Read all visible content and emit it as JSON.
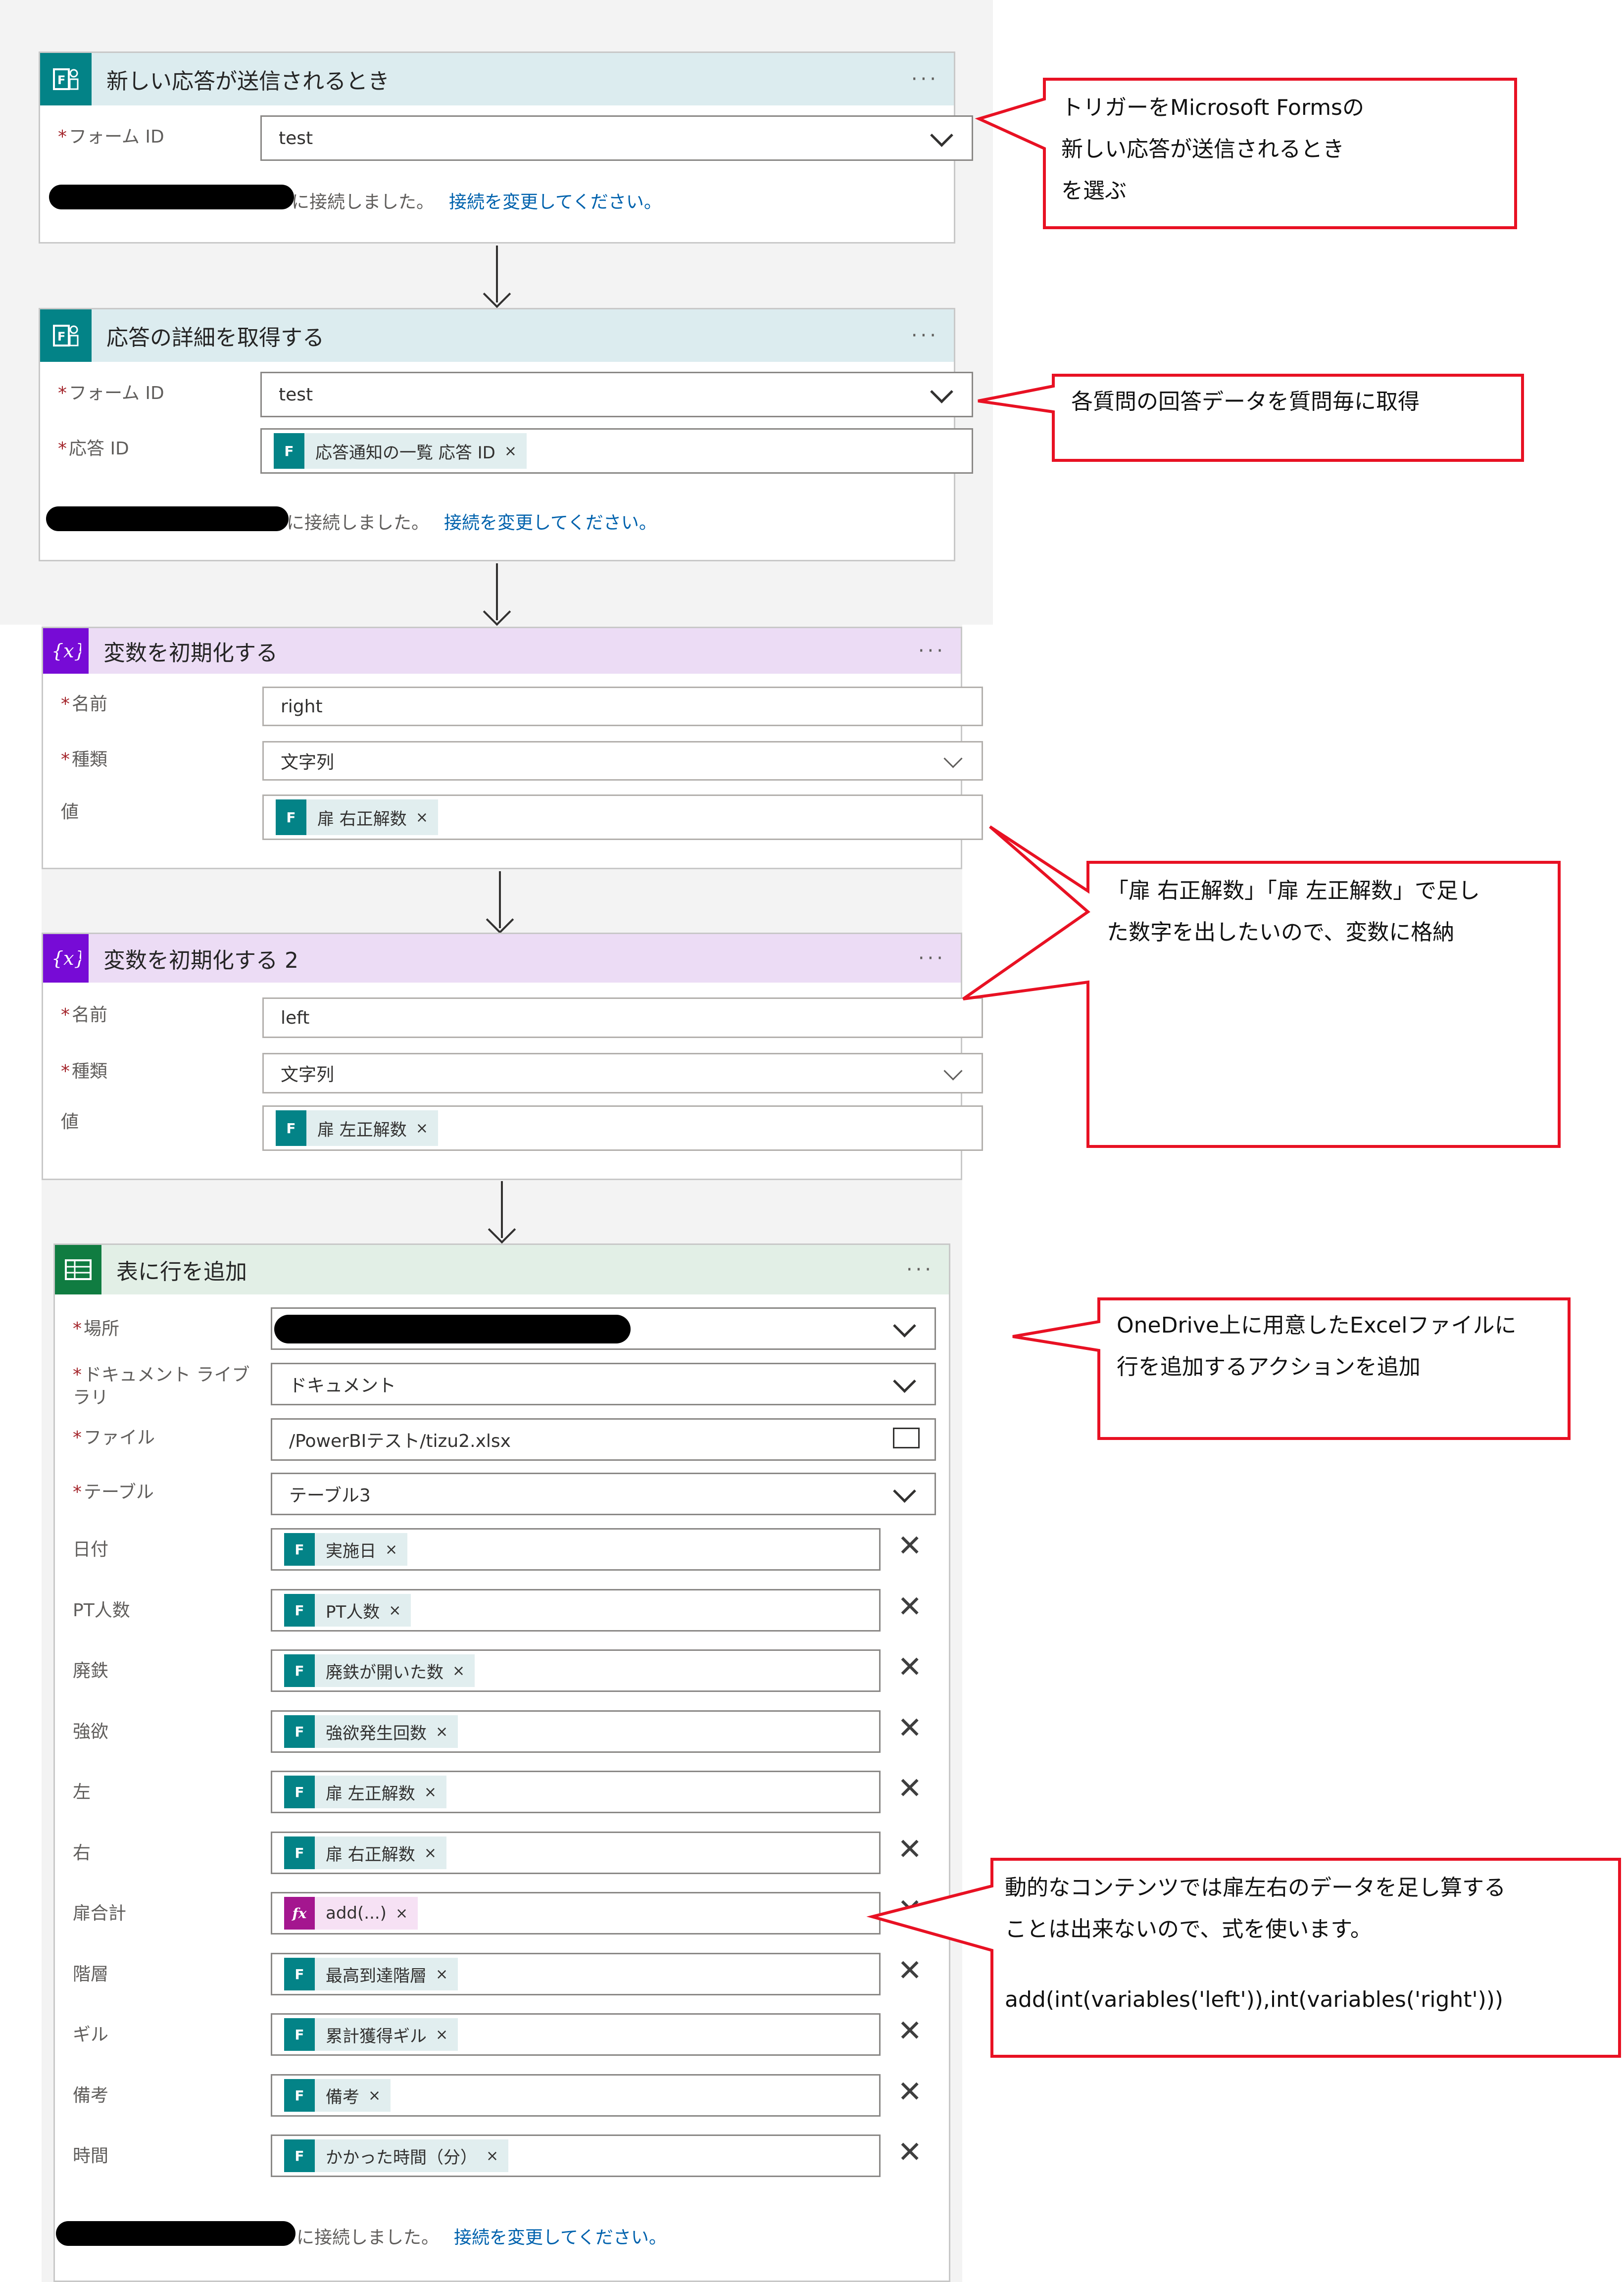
{
  "cards": {
    "trigger": {
      "title": "新しい応答が送信されるとき",
      "more": "···",
      "form_id_label": "フォーム ID",
      "form_id_value": "test",
      "connected_text": "に接続しました。",
      "change_link": "接続を変更してください。"
    },
    "get_details": {
      "title": "応答の詳細を取得する",
      "more": "···",
      "form_id_label": "フォーム ID",
      "form_id_value": "test",
      "response_id_label": "応答 ID",
      "response_id_token": "応答通知の一覧 応答 ID",
      "connected_text": "に接続しました。",
      "change_link": "接続を変更してください。"
    },
    "init_var_1": {
      "title": "変数を初期化する",
      "more": "···",
      "name_label": "名前",
      "name_value": "right",
      "type_label": "種類",
      "type_value": "文字列",
      "value_label": "値",
      "value_token": "扉 右正解数"
    },
    "init_var_2": {
      "title": "変数を初期化する 2",
      "more": "···",
      "name_label": "名前",
      "name_value": "left",
      "type_label": "種類",
      "type_value": "文字列",
      "value_label": "値",
      "value_token": "扉 左正解数"
    },
    "add_row": {
      "title": "表に行を追加",
      "more": "···",
      "location_label": "場所",
      "doclib_label_1": "ドキュメント ライブ",
      "doclib_label_2": "ラリ",
      "doclib_value": "ドキュメント",
      "file_label": "ファイル",
      "file_value": "/PowerBIテスト/tizu2.xlsx",
      "table_label": "テーブル",
      "table_value": "テーブル3",
      "rows": [
        {
          "label": "日付",
          "token": "実施日",
          "kind": "forms"
        },
        {
          "label": "PT人数",
          "token": "PT人数",
          "kind": "forms"
        },
        {
          "label": "廃鉄",
          "token": "廃鉄が開いた数",
          "kind": "forms"
        },
        {
          "label": "強欲",
          "token": "強欲発生回数",
          "kind": "forms"
        },
        {
          "label": "左",
          "token": "扉 左正解数",
          "kind": "forms"
        },
        {
          "label": "右",
          "token": "扉 右正解数",
          "kind": "forms"
        },
        {
          "label": "扉合計",
          "token": "add(...)",
          "kind": "fx"
        },
        {
          "label": "階層",
          "token": "最高到達階層",
          "kind": "forms"
        },
        {
          "label": "ギル",
          "token": "累計獲得ギル",
          "kind": "forms"
        },
        {
          "label": "備考",
          "token": "備考",
          "kind": "forms"
        },
        {
          "label": "時間",
          "token": "かかった時間（分）",
          "kind": "forms"
        }
      ],
      "token_remove": "×",
      "row_remove": "✕",
      "connected_text": "に接続しました。",
      "change_link": "接続を変更してください。"
    }
  },
  "callouts": {
    "c1": [
      "トリガーをMicrosoft Formsの",
      "新しい応答が送信されるとき",
      "を選ぶ"
    ],
    "c2": [
      "各質問の回答データを質問毎に取得"
    ],
    "c3": [
      "「扉 右正解数」「扉 左正解数」で足し",
      "た数字を出したいので、変数に格納"
    ],
    "c4": [
      "OneDrive上に用意したExcelファイルに",
      "行を追加するアクションを追加"
    ],
    "c5": [
      "動的なコンテンツでは扉左右のデータを足し算する",
      "ことは出来ないので、式を使います。",
      "",
      "add(int(variables('left')),int(variables('right')))"
    ]
  },
  "colors": {
    "forms": "#038387",
    "variable": "#770bd6",
    "excel": "#107c41",
    "callout_border": "#e81123",
    "link": "#0062ad"
  }
}
